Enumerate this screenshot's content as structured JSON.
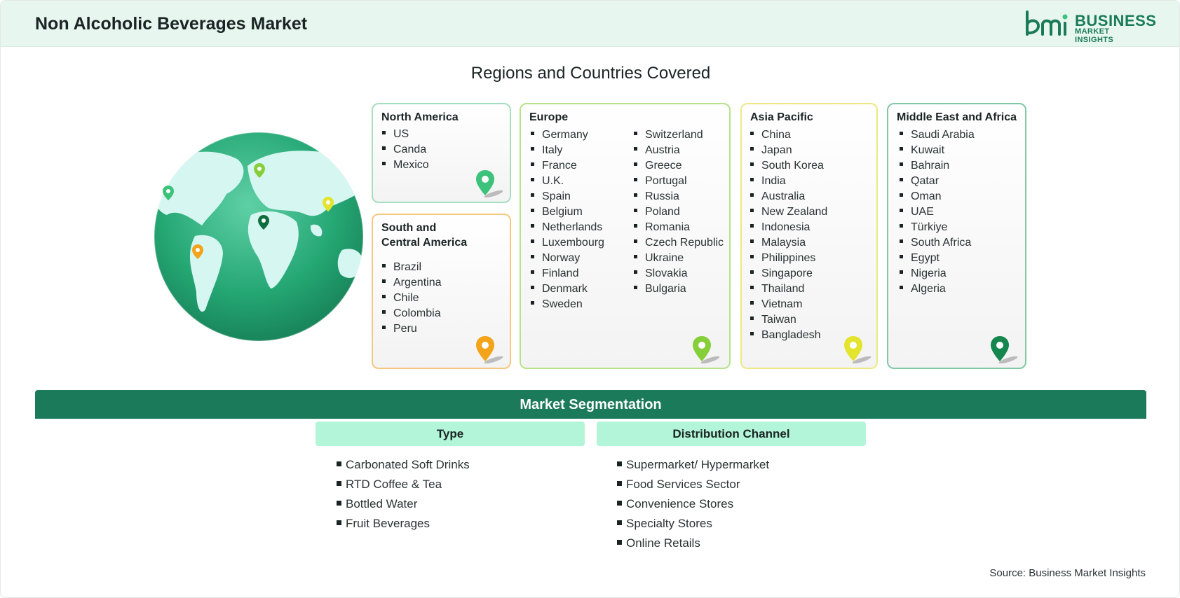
{
  "header": {
    "title": "Non Alcoholic Beverages Market",
    "logo_line1": "BUSINESS",
    "logo_line2": "MARKET INSIGHTS"
  },
  "regions": {
    "title": "Regions and Countries Covered",
    "north_america": {
      "title": "North America",
      "countries": [
        "US",
        "Canda",
        "Mexico"
      ],
      "pin_color": "#3cc27a"
    },
    "south_central_america": {
      "title_line1": "South and",
      "title_line2": "Central America",
      "countries": [
        "Brazil",
        "Argentina",
        "Chile",
        "Colombia",
        "Peru"
      ],
      "pin_color": "#f3a41b"
    },
    "europe": {
      "title": "Europe",
      "countries_col1": [
        "Germany",
        "Italy",
        "France",
        "U.K.",
        "Spain",
        "Belgium",
        "Netherlands",
        "Luxembourg",
        "Norway",
        "Finland",
        "Denmark",
        "Sweden"
      ],
      "countries_col2": [
        "Switzerland",
        "Austria",
        "Greece",
        "Portugal",
        "Russia",
        "Poland",
        "Romania",
        "Czech Republic",
        "Ukraine",
        "Slovakia",
        "Bulgaria"
      ],
      "pin_color": "#86cf3a"
    },
    "asia_pacific": {
      "title": "Asia Pacific",
      "countries": [
        "China",
        "Japan",
        "South Korea",
        "India",
        "Australia",
        "New Zealand",
        "Indonesia",
        "Malaysia",
        "Philippines",
        "Singapore",
        "Thailand",
        "Vietnam",
        "Taiwan",
        "Bangladesh"
      ],
      "pin_color": "#e2e42e"
    },
    "middle_east_africa": {
      "title": "Middle East and Africa",
      "countries": [
        "Saudi Arabia",
        "Kuwait",
        "Bahrain",
        "Qatar",
        "Oman",
        "UAE",
        "Türkiye",
        "South Africa",
        "Egypt",
        "Nigeria",
        "Algeria"
      ],
      "pin_color": "#16864f"
    }
  },
  "segmentation": {
    "title": "Market Segmentation",
    "type": {
      "title": "Type",
      "items": [
        "Carbonated Soft Drinks",
        "RTD Coffee & Tea",
        "Bottled Water",
        "Fruit Beverages"
      ]
    },
    "distribution": {
      "title": "Distribution Channel",
      "items": [
        "Supermarket/ Hypermarket",
        "Food Services Sector",
        "Convenience Stores",
        "Specialty Stores",
        "Online Retails"
      ]
    }
  },
  "source": "Source: Business Market Insights",
  "colors": {
    "brand": "#1a7a5a",
    "header_bg": "#e7f7ef",
    "segment_head_bg": "#b2f5d8"
  }
}
